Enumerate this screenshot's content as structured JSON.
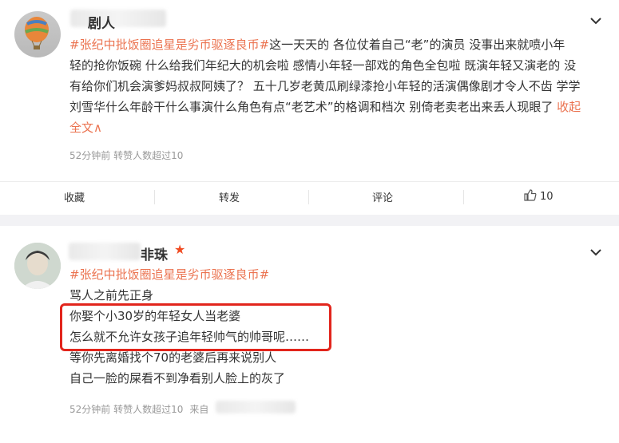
{
  "post1": {
    "username": "剧人",
    "content_lines": [
      {
        "tag": "#张纪中批饭圈追星是劣币驱逐良币#",
        "text": "这一天天的 各位仗着自己“老”的演员 没事出来就喷小年"
      },
      {
        "text": "轻的抢你饭碗 什么给我们年纪大的机会啦 感情小年轻一部戏的角色全包啦 既演年轻又演老的 没"
      },
      {
        "text": "有给你们机会演爹妈叔叔阿姨了？  五十几岁老黄瓜刷绿漆抢小年轻的活演偶像剧才令人不齿 学学"
      },
      {
        "text": "刘雪华什么年龄干什么事演什么角色有点“老艺术”的格调和档次 别倚老卖老出来丢人现眼了 ",
        "link": "收起"
      },
      {
        "link": "全文∧"
      }
    ],
    "meta": "52分钟前 转赞人数超过10",
    "actions": {
      "favorite": "收藏",
      "forward": "转发",
      "comment": "评论",
      "like_count": "10"
    }
  },
  "post2": {
    "username": "非珠",
    "tag": "#张纪中批饭圈追星是劣币驱逐良币#",
    "lines": [
      "骂人之前先正身",
      "你娶个小30岁的年轻女人当老婆",
      "怎么就不允许女孩子追年轻帅气的帅哥呢……",
      "等你先离婚找个70的老婆后再来说别人",
      "自己一脸的屎看不到净看别人脸上的灰了"
    ],
    "meta": "52分钟前 转赞人数超过10",
    "meta_source": "来自"
  },
  "colors": {
    "accent": "#eb7350",
    "highlight_box": "#e2251c"
  }
}
